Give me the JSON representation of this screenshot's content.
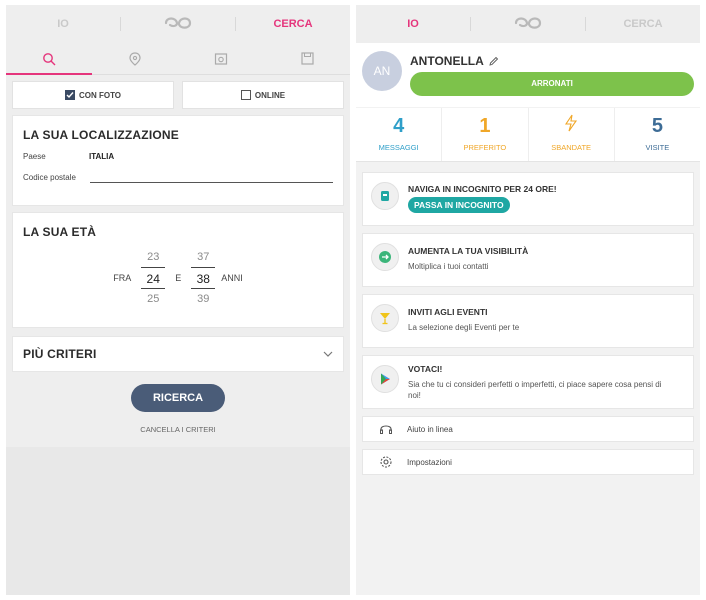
{
  "left": {
    "topbar": {
      "tab_io": "IO",
      "tab_cerca": "CERCA"
    },
    "filters": {
      "con_foto": "CON FOTO",
      "online": "ONLINE"
    },
    "location": {
      "title": "LA SUA LOCALIZZAZIONE",
      "country_label": "Paese",
      "country_value": "ITALIA",
      "postal_label": "Codice postale",
      "postal_value": ""
    },
    "age": {
      "title": "LA SUA ETÀ",
      "from_label": "FRA",
      "between_label": "E",
      "years_label": "ANNI",
      "min_prev": "23",
      "min_sel": "24",
      "min_next": "25",
      "max_prev": "37",
      "max_sel": "38",
      "max_next": "39"
    },
    "more_criteria": "PIÙ CRITERI",
    "search_button": "RICERCA",
    "reset": "CANCELLA I CRITERI"
  },
  "right": {
    "topbar": {
      "tab_io": "IO",
      "tab_cerca": "CERCA"
    },
    "profile": {
      "avatar_initials": "AN",
      "name": "ANTONELLA",
      "boost_button": "ARRONATI"
    },
    "stats": [
      {
        "value": "4",
        "label": "MESSAGGI",
        "color": "#2f9fc9"
      },
      {
        "value": "1",
        "label": "PREFERITO",
        "color": "#f0a728"
      },
      {
        "value": "",
        "label": "SBANDATE",
        "color": "#f0a728"
      },
      {
        "value": "5",
        "label": "VISITE",
        "color": "#3d6c96"
      }
    ],
    "features": [
      {
        "title": "NAVIGA IN INCOGNITO PER 24 ORE!",
        "button": "PASSA IN INCOGNITO",
        "icon": "incognito-icon"
      },
      {
        "title": "AUMENTA LA TUA VISIBILITÀ",
        "desc": "Moltiplica i tuoi contatti",
        "icon": "visibility-icon"
      },
      {
        "title": "INVITI AGLI EVENTI",
        "desc": "La selezione degli Eventi per te",
        "icon": "cocktail-icon"
      },
      {
        "title": "VOTACI!",
        "desc": "Sia che tu ci consideri perfetti o imperfetti, ci piace sapere cosa pensi di noi!",
        "icon": "play-store-icon"
      }
    ],
    "help": "Aiuto in linea",
    "settings": "Impostazioni"
  },
  "colors": {
    "accent": "#e5357c",
    "green": "#7dc24b",
    "teal": "#1fa7a3",
    "navy": "#4a5c78"
  }
}
